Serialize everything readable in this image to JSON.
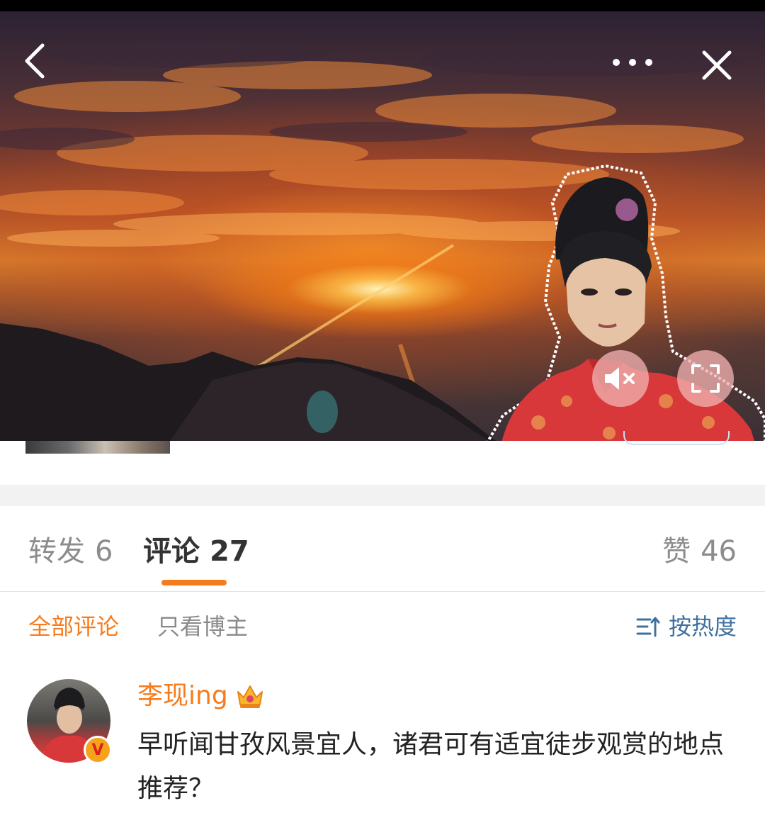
{
  "header": {
    "back_icon": "chevron-left-icon",
    "more_icon": "more-horizontal-icon",
    "close_icon": "close-icon"
  },
  "video": {
    "mute_icon": "volume-muted-icon",
    "fullscreen_icon": "fullscreen-icon"
  },
  "tabs": [
    {
      "label": "转发",
      "count": "6"
    },
    {
      "label": "评论",
      "count": "27"
    },
    {
      "label": "赞",
      "count": "46"
    }
  ],
  "filters": {
    "all": "全部评论",
    "owner_only": "只看博主",
    "sort_label": "按热度",
    "sort_icon": "sort-icon"
  },
  "comment": {
    "username": "李现ing",
    "badge_icon": "crown-icon",
    "verified_badge": "V",
    "text": "早听闻甘孜风景宜人，诸君可有适宜徒步观赏的地点推荐？"
  },
  "colors": {
    "accent": "#f77b1c",
    "link_blue": "#40709e",
    "muted_text": "#8c8c8c"
  }
}
